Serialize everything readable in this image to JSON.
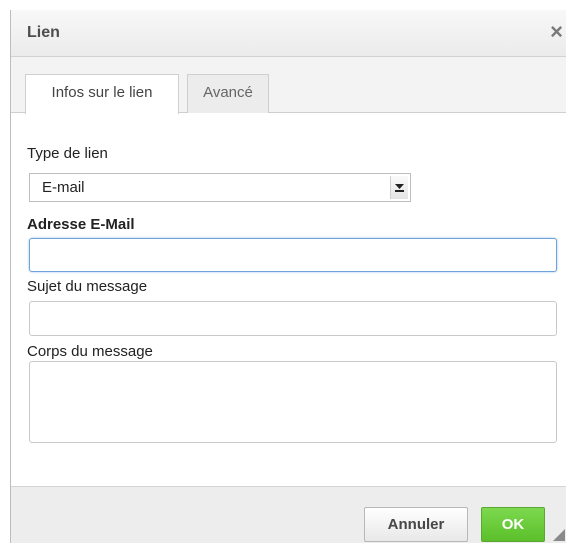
{
  "dialog": {
    "title": "Lien",
    "close_symbol": "×"
  },
  "tabs": [
    {
      "label": "Infos sur le lien",
      "active": true
    },
    {
      "label": "Avancé",
      "active": false
    }
  ],
  "form": {
    "link_type_label": "Type de lien",
    "link_type_value": "E-mail",
    "email_label": "Adresse E-Mail",
    "email_value": "",
    "subject_label": "Sujet du message",
    "subject_value": "",
    "body_label": "Corps du message",
    "body_value": ""
  },
  "footer": {
    "cancel_label": "Annuler",
    "ok_label": "OK"
  },
  "colors": {
    "ok_button": "#5cbf2a",
    "focus_border": "#6fa2d6"
  },
  "icons": {
    "close": "close-icon",
    "dropdown": "chevron-down-icon",
    "resize": "resize-grip-icon"
  }
}
